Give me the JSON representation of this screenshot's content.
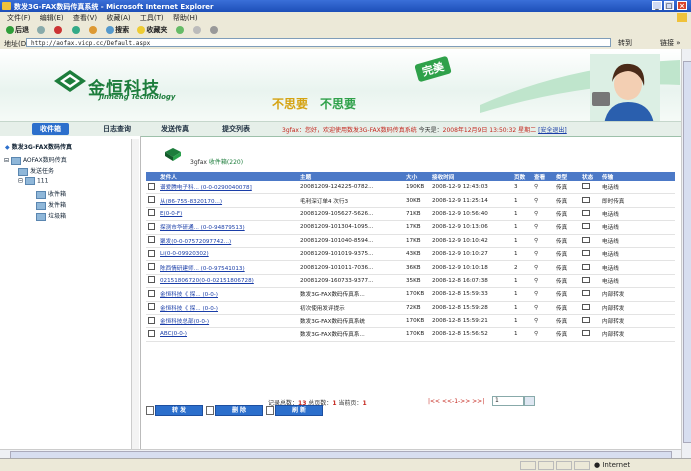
{
  "window": {
    "title": "数发3G-FAX数码传真系统 - Microsoft Internet Explorer",
    "min": "_",
    "max": "□",
    "close": "×"
  },
  "menu": [
    "文件(F)",
    "编辑(E)",
    "查看(V)",
    "收藏(A)",
    "工具(T)",
    "帮助(H)"
  ],
  "toolbar": {
    "back": "后退",
    "search": "搜索",
    "favorites": "收藏夹"
  },
  "address": {
    "label": "地址(D)",
    "url": "http://aofax.vicp.cc/Default.aspx",
    "go": "转到",
    "links": "链接 »"
  },
  "banner": {
    "logo": "金恒科技",
    "logo_sub": "Jinheng Technology",
    "slogan1": "不思要",
    "slogan2": "不思要",
    "badge": "完美 "
  },
  "nav": {
    "tabs": [
      "收件箱",
      "日志查询",
      "发送传真",
      "提交列表"
    ],
    "welcome_user": "3gfax",
    "welcome_msg": "：您好，欢迎使用数发3G-FAX数码传真系统",
    "today_label": "今天是：",
    "today": "2008年12月9日 13:50:32 星期二",
    "logout": "[安全退出]"
  },
  "tree": {
    "root": "数发3G-FAX数码传真",
    "group": "AOFAX数码传真",
    "send": "发送任务",
    "user": "111",
    "folders": [
      "收件箱",
      "发件箱",
      "垃圾箱"
    ]
  },
  "folder": {
    "user": "3gfax",
    "name": "收件箱",
    "count": "(220)"
  },
  "table": {
    "headers": [
      "",
      "发件人",
      "主题",
      "大小",
      "接收时间",
      "页数",
      "查看",
      "类型",
      "状态",
      "传输"
    ],
    "rows": [
      {
        "sender": "谱爱腾电子科... (0-0-0290040078]",
        "subject": "20081209-124225-0782...",
        "size": "190KB",
        "time": "2008-12-9 12:43:03",
        "pages": "3",
        "type": "传真",
        "xfer": "电话线"
      },
      {
        "sender": "从(86-755-8320170...)",
        "subject": "毛利深订单4 次行3",
        "size": "30KB",
        "time": "2008-12-9 11:25:14",
        "pages": "1",
        "type": "传真",
        "xfer": "即时传真"
      },
      {
        "sender": "E(0-0-F)",
        "subject": "20081209-105627-5626...",
        "size": "71KB",
        "time": "2008-12-9 10:56:40",
        "pages": "1",
        "type": "传真",
        "xfer": "电话线"
      },
      {
        "sender": "探测市华研通... (0-0-94879513)",
        "subject": "20081209-101304-1095...",
        "size": "17KB",
        "time": "2008-12-9 10:13:06",
        "pages": "1",
        "type": "传真",
        "xfer": "电话线"
      },
      {
        "sender": "聚发(0-0-07572097742...)",
        "subject": "20081209-101040-8594...",
        "size": "17KB",
        "time": "2008-12-9 10:10:42",
        "pages": "1",
        "type": "传真",
        "xfer": "电话线"
      },
      {
        "sender": "Li(0-0-09920302)",
        "subject": "20081209-101019-9375...",
        "size": "43KB",
        "time": "2008-12-9 10:10:27",
        "pages": "1",
        "type": "传真",
        "xfer": "电话线"
      },
      {
        "sender": "陈西情研建师... (0-0-97541013)",
        "subject": "20081209-101011-7036...",
        "size": "36KB",
        "time": "2008-12-9 10:10:18",
        "pages": "2",
        "type": "传真",
        "xfer": "电话线"
      },
      {
        "sender": "02151806720(0-0-02151806728)",
        "subject": "20081209-160733-9377...",
        "size": "35KB",
        "time": "2008-12-8 16:07:38",
        "pages": "1",
        "type": "传真",
        "xfer": "电话线"
      },
      {
        "sender": "金恒科技《 探... (0-0-)",
        "subject": "数发3G-FAX数码传真系...",
        "size": "170KB",
        "time": "2008-12-8 15:59:33",
        "pages": "1",
        "type": "传真",
        "xfer": "内部转发"
      },
      {
        "sender": "金恒科技《 探... (0-0-)",
        "subject": "初次使用发评提示",
        "size": "72KB",
        "time": "2008-12-8 15:59:28",
        "pages": "1",
        "type": "传真",
        "xfer": "内部转发"
      },
      {
        "sender": "金恒科技总部(0-0-)",
        "subject": "数发3G-FAX数码传真系统",
        "size": "170KB",
        "time": "2008-12-8 15:59:21",
        "pages": "1",
        "type": "传真",
        "xfer": "内部转发"
      },
      {
        "sender": "ABC(0-0-)",
        "subject": "数发3G-FAX数码传真系...",
        "size": "170KB",
        "time": "2008-12-8 15:56:52",
        "pages": "1",
        "type": "传真",
        "xfer": "内部转发"
      }
    ]
  },
  "pager": {
    "total_label": "记录总数：",
    "total": "13",
    "pages_label": "总页数：",
    "pages": "1",
    "current_label": "当前页：",
    "current": "1",
    "nav": "|<< <<-1->> >>|",
    "input": "1"
  },
  "buttons": {
    "forward": "转 发",
    "delete": "删 除",
    "refresh": "刷 新"
  },
  "status": {
    "zone": "Internet"
  }
}
